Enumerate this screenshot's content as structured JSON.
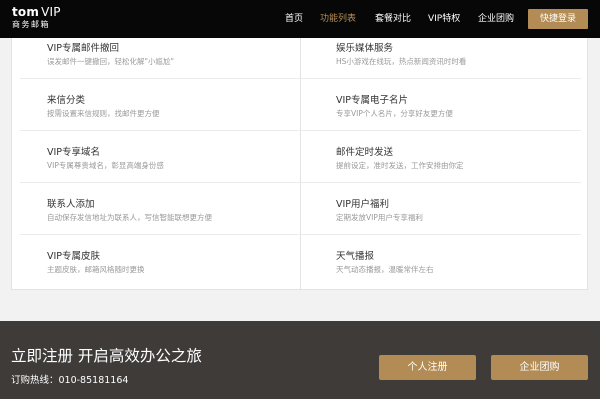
{
  "header": {
    "logo_main": "tom",
    "logo_vip": "VIP",
    "logo_sub": "商务邮箱",
    "nav": [
      "首页",
      "功能列表",
      "套餐对比",
      "VIP特权",
      "企业团购"
    ],
    "active_nav": "功能列表",
    "login_button": "快捷登录"
  },
  "features": [
    {
      "title": "VIP专属邮件撤回",
      "desc": "误发邮件一键撤回，轻松化解\"小尴尬\""
    },
    {
      "title": "娱乐媒体服务",
      "desc": "HS小游戏在线玩，热点新闻资讯时时看"
    },
    {
      "title": "来信分类",
      "desc": "按需设置来信规则，找邮件更方便"
    },
    {
      "title": "VIP专属电子名片",
      "desc": "专享VIP个人名片，分享好友更方便"
    },
    {
      "title": "VIP专享域名",
      "desc": "VIP专属尊贵域名，彰显高端身份感"
    },
    {
      "title": "邮件定时发送",
      "desc": "提前设定，准时发送，工作安排由你定"
    },
    {
      "title": "联系人添加",
      "desc": "自动保存发信地址为联系人，写信智能联想更方便"
    },
    {
      "title": "VIP用户福利",
      "desc": "定期发放VIP用户专享福利"
    },
    {
      "title": "VIP专属皮肤",
      "desc": "主题皮肤，邮箱风格随时更换"
    },
    {
      "title": "天气播报",
      "desc": "天气动态播报，温暖常伴左右"
    }
  ],
  "footer": {
    "slogan": "立即注册 开启高效办公之旅",
    "hotline": "订购热线：010-85181164",
    "personal_register": "个人注册",
    "enterprise_buy": "企业团购"
  },
  "colors": {
    "navbar_bg": "#070707",
    "accent_gold": "#b28c54",
    "footer_bg": "#3e3b39"
  }
}
